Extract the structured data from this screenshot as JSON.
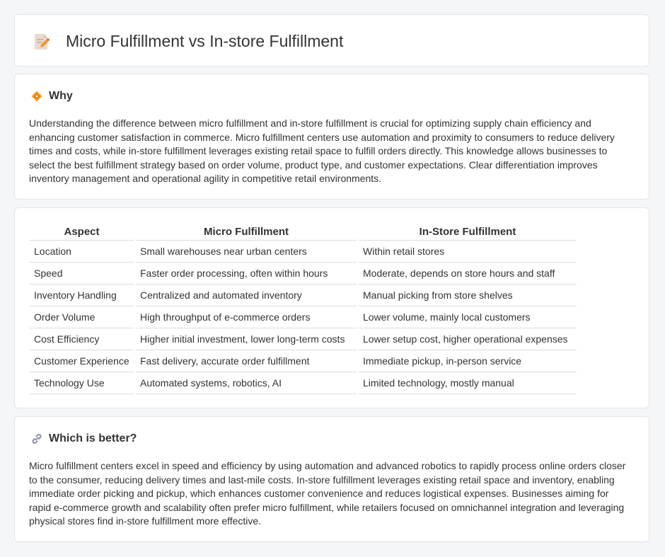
{
  "header": {
    "title": "Micro Fulfillment vs In-store Fulfillment",
    "icon": "document-pencil-icon"
  },
  "why": {
    "title": "Why",
    "icon": "diamond-icon",
    "text": "Understanding the difference between micro fulfillment and in-store fulfillment is crucial for optimizing supply chain efficiency and enhancing customer satisfaction in commerce. Micro fulfillment centers use automation and proximity to consumers to reduce delivery times and costs, while in-store fulfillment leverages existing retail space to fulfill orders directly. This knowledge allows businesses to select the best fulfillment strategy based on order volume, product type, and customer expectations. Clear differentiation improves inventory management and operational agility in competitive retail environments."
  },
  "table": {
    "headers": [
      "Aspect",
      "Micro Fulfillment",
      "In-Store Fulfillment"
    ],
    "rows": [
      [
        "Location",
        "Small warehouses near urban centers",
        "Within retail stores"
      ],
      [
        "Speed",
        "Faster order processing, often within hours",
        "Moderate, depends on store hours and staff"
      ],
      [
        "Inventory Handling",
        "Centralized and automated inventory",
        "Manual picking from store shelves"
      ],
      [
        "Order Volume",
        "High throughput of e-commerce orders",
        "Lower volume, mainly local customers"
      ],
      [
        "Cost Efficiency",
        "Higher initial investment, lower long-term costs",
        "Lower setup cost, higher operational expenses"
      ],
      [
        "Customer Experience",
        "Fast delivery, accurate order fulfillment",
        "Immediate pickup, in-person service"
      ],
      [
        "Technology Use",
        "Automated systems, robotics, AI",
        "Limited technology, mostly manual"
      ]
    ]
  },
  "better": {
    "title": "Which is better?",
    "icon": "link-icon",
    "text": "Micro fulfillment centers excel in speed and efficiency by using automation and advanced robotics to rapidly process online orders closer to the consumer, reducing delivery times and last-mile costs. In-store fulfillment leverages existing retail space and inventory, enabling immediate order picking and pickup, which enhances customer convenience and reduces logistical expenses. Businesses aiming for rapid e-commerce growth and scalability often prefer micro fulfillment, while retailers focused on omnichannel integration and leveraging physical stores find in-store fulfillment more effective."
  },
  "colors": {
    "accent_orange": "#f0922e",
    "background": "#f5f6f8",
    "card": "#ffffff",
    "border": "#e3e5e8"
  }
}
